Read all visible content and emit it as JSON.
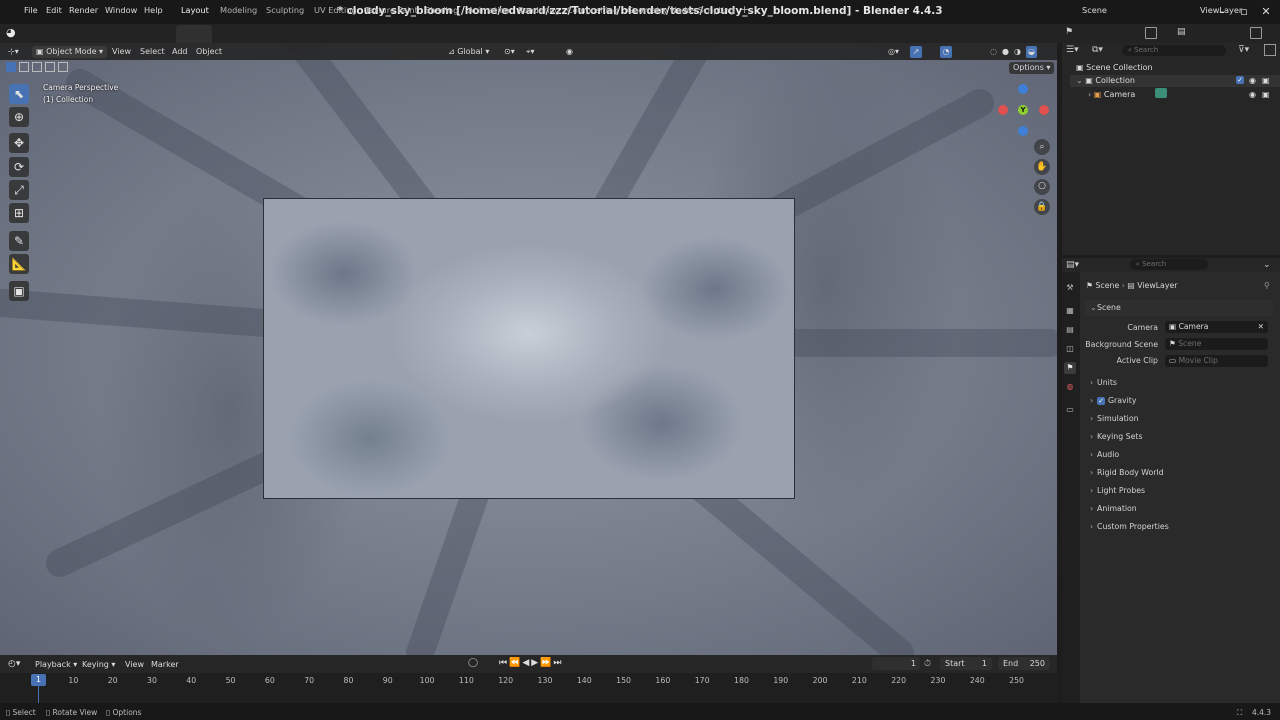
{
  "window": {
    "title": "* cloudy_sky_bloom [/home/edward/zzz/Tutorial/blender/tests/cloudy_sky_bloom.blend] - Blender 4.4.3",
    "minimize": "–",
    "maximize": "▫",
    "close": "✕"
  },
  "menus": [
    "File",
    "Edit",
    "Render",
    "Window",
    "Help"
  ],
  "workspaces": [
    "Layout",
    "Modeling",
    "Sculpting",
    "UV Editing",
    "Texture Paint",
    "Shading",
    "Animation",
    "Rendering",
    "Compositing",
    "Geometry Nodes",
    "Scripting"
  ],
  "add_workspace": "+",
  "scene_selector": {
    "label": "Scene"
  },
  "view_layer_selector": {
    "label": "ViewLayer"
  },
  "viewport": {
    "mode": "Object Mode",
    "header_menus": [
      "View",
      "Select",
      "Add",
      "Object"
    ],
    "orientation": "Global",
    "options": "Options",
    "overlay_line1": "Camera Perspective",
    "overlay_line2": "(1) Collection",
    "gizmo_y": "Y"
  },
  "timeline": {
    "menus": [
      "Playback",
      "Keying",
      "View",
      "Marker"
    ],
    "current_frame": "1",
    "start_label": "Start",
    "start_value": "1",
    "end_label": "End",
    "end_value": "250",
    "ticks": [
      "10",
      "20",
      "30",
      "40",
      "50",
      "60",
      "70",
      "80",
      "90",
      "100",
      "110",
      "120",
      "130",
      "140",
      "150",
      "160",
      "170",
      "180",
      "190",
      "200",
      "210",
      "220",
      "230",
      "240",
      "250"
    ],
    "marker_frame": "1"
  },
  "status_bar": {
    "select": "Select",
    "rotate_view": "Rotate View",
    "options": "Options",
    "version": "4.4.3"
  },
  "outliner": {
    "search_placeholder": "Search",
    "root": "Scene Collection",
    "collection": "Collection",
    "camera": "Camera"
  },
  "properties": {
    "search_placeholder": "Search",
    "breadcrumb_scene": "Scene",
    "breadcrumb_viewlayer": "ViewLayer",
    "panel_title": "Scene",
    "camera_label": "Camera",
    "camera_value": "Camera",
    "background_scene_label": "Background Scene",
    "background_scene_placeholder": "Scene",
    "active_clip_label": "Active Clip",
    "active_clip_placeholder": "Movie Clip",
    "panels": [
      "Units",
      "Gravity",
      "Simulation",
      "Keying Sets",
      "Audio",
      "Rigid Body World",
      "Light Probes",
      "Animation",
      "Custom Properties"
    ],
    "gravity_checked": true
  },
  "colors": {
    "accent": "#4772b3",
    "axis_x": "#e0504f",
    "axis_y": "#8ccf2e",
    "axis_z": "#3f7fd8"
  }
}
